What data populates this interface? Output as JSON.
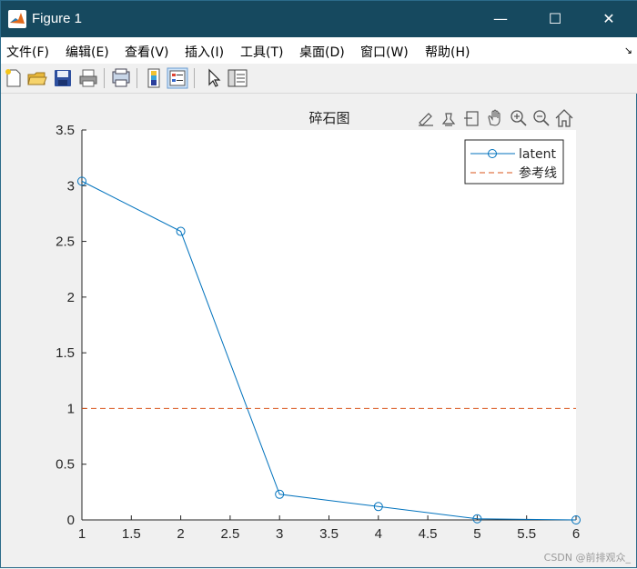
{
  "window": {
    "title": "Figure 1",
    "minimize_glyph": "—",
    "maximize_glyph": "☐",
    "close_glyph": "✕"
  },
  "menubar": {
    "items": [
      "文件(F)",
      "编辑(E)",
      "查看(V)",
      "插入(I)",
      "工具(T)",
      "桌面(D)",
      "窗口(W)",
      "帮助(H)"
    ],
    "overflow_glyph": "↘"
  },
  "toolbar": {
    "icons": [
      "new-figure-icon",
      "open-file-icon",
      "save-icon",
      "print-icon",
      "print-preview-icon",
      "colorbar-icon",
      "legend-icon",
      "pointer-icon",
      "property-inspector-icon"
    ]
  },
  "axes_toolbar": {
    "icons": [
      "brush-data-icon",
      "data-tips-icon",
      "select-icon",
      "pan-icon",
      "zoom-in-icon",
      "zoom-out-icon",
      "home-icon"
    ]
  },
  "watermark": "CSDN @前排观众_",
  "chart_data": {
    "type": "line",
    "title": "碎石图",
    "xlabel": "",
    "ylabel": "",
    "xlim": [
      1,
      6
    ],
    "ylim": [
      0,
      3.5
    ],
    "xticks": [
      "1",
      "1.5",
      "2",
      "2.5",
      "3",
      "3.5",
      "4",
      "4.5",
      "5",
      "5.5",
      "6"
    ],
    "yticks": [
      "0",
      "0.5",
      "1",
      "1.5",
      "2",
      "2.5",
      "3",
      "3.5"
    ],
    "grid": false,
    "legend_position": "top-right",
    "series": [
      {
        "name": "latent",
        "x": [
          1,
          2,
          3,
          4,
          5,
          6
        ],
        "y": [
          3.04,
          2.59,
          0.23,
          0.12,
          0.01,
          0.0
        ],
        "color": "#0072BD",
        "marker": "circle",
        "style": "solid"
      },
      {
        "name": "参考线",
        "x": [
          1,
          6
        ],
        "y": [
          1,
          1
        ],
        "color": "#D95319",
        "marker": "none",
        "style": "dashed"
      }
    ]
  }
}
